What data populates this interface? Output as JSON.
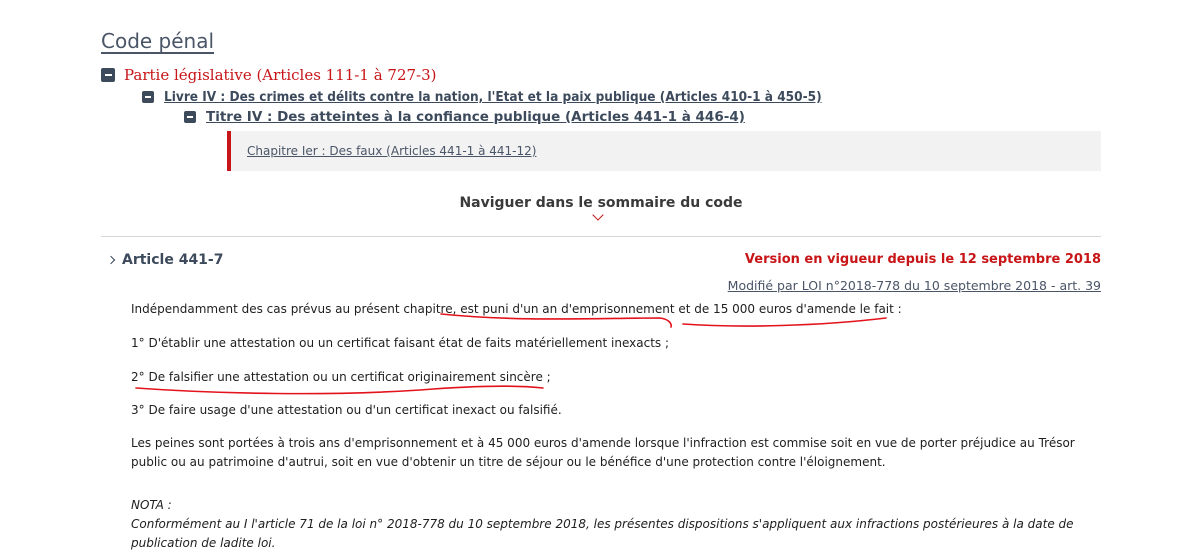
{
  "page_title": "Code pénal",
  "tree": {
    "level1": "Partie législative (Articles 111-1 à 727-3)",
    "level2": "Livre IV : Des crimes et délits contre la nation, l'Etat et la paix publique (Articles 410-1 à 450-5)",
    "level3": "Titre IV : Des atteintes à la confiance publique (Articles 441-1 à 446-4)",
    "chapter": "Chapitre Ier : Des faux (Articles 441-1 à 441-12)"
  },
  "nav_summary": "Naviguer dans le sommaire du code",
  "article": {
    "title": "Article 441-7",
    "version": "Version en vigueur depuis le 12 septembre 2018",
    "modified": "Modifié par LOI n°2018-778 du 10 septembre 2018 - art. 39",
    "paragraphs": [
      "Indépendamment des cas prévus au présent chapitre, est puni d'un an d'emprisonnement et de 15 000 euros d'amende le fait :",
      "1° D'établir une attestation ou un certificat faisant état de faits matériellement inexacts ;",
      "2° De falsifier une attestation ou un certificat originairement sincère ;",
      "3° De faire usage d'une attestation ou d'un certificat inexact ou falsifié.",
      "Les peines sont portées à trois ans d'emprisonnement et à 45 000 euros d'amende lorsque l'infraction est commise soit en vue de porter préjudice au Trésor public ou au patrimoine d'autrui, soit en vue d'obtenir un titre de séjour ou le bénéfice d'une protection contre l'éloignement."
    ],
    "nota_label": "NOTA :",
    "nota_text": "Conformément au I l'article 71 de la loi n° 2018-778 du 10 septembre 2018, les présentes dispositions s'appliquent aux infractions postérieures à la date de publication de ladite loi."
  },
  "colors": {
    "accent_red": "#c71518",
    "navy": "#3c4a5c",
    "annotation": "#e3121b"
  },
  "icons": [
    "collapse-icon",
    "chevron-down-icon",
    "chevron-right-icon"
  ]
}
